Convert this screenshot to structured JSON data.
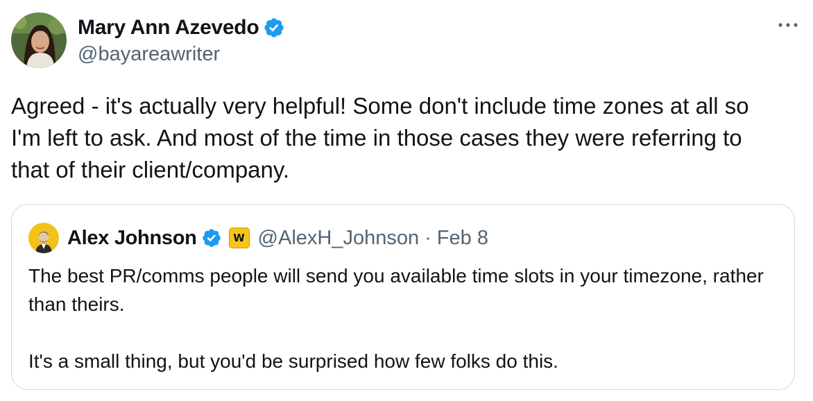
{
  "author": {
    "display_name": "Mary Ann Azevedo",
    "handle": "@bayareawriter",
    "verified": true,
    "avatar_icon": "profile-photo"
  },
  "more_icon": "more-horizontal-icon",
  "tweet": {
    "text": "Agreed - it's actually very helpful! Some don't include time zones at all so\nI'm left to ask. And most of the time  in those cases they were referring to\nthat of their client/company."
  },
  "quote": {
    "author": {
      "display_name": "Alex Johnson",
      "verified": true,
      "badge_label": "W",
      "handle": "@AlexH_Johnson",
      "separator": "·",
      "date": "Feb 8"
    },
    "paragraphs": [
      "The best PR/comms people will send you available time slots in your timezone, rather than theirs.",
      "It's a small thing, but you'd be surprised how few folks do this."
    ]
  },
  "colors": {
    "verified_blue": "#1d9bf0",
    "secondary_text": "#536471",
    "border": "#cfd9de",
    "badge_yellow": "#f5c518"
  }
}
